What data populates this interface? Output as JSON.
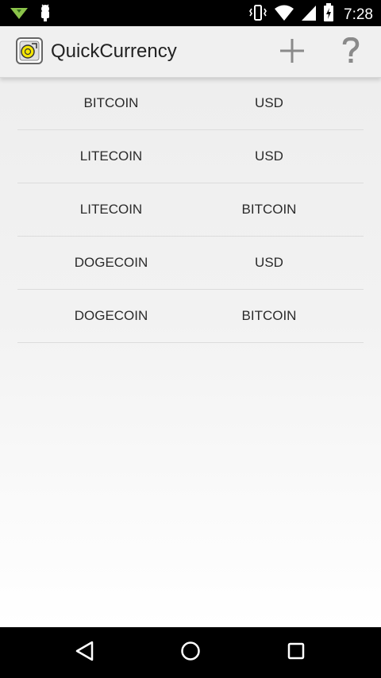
{
  "status_bar": {
    "time": "7:28",
    "icons": [
      "wifi-download-icon",
      "android-debug-icon",
      "vibrate-icon",
      "wifi-icon",
      "signal-icon",
      "battery-charging-icon"
    ]
  },
  "action_bar": {
    "title": "QuickCurrency",
    "app_icon": "quickcurrency-app-icon",
    "add_icon": "plus-icon",
    "help_icon": "question-mark-icon"
  },
  "pairs": [
    {
      "from": "BITCOIN",
      "to": "USD"
    },
    {
      "from": "LITECOIN",
      "to": "USD"
    },
    {
      "from": "LITECOIN",
      "to": "BITCOIN"
    },
    {
      "from": "DOGECOIN",
      "to": "USD"
    },
    {
      "from": "DOGECOIN",
      "to": "BITCOIN"
    }
  ],
  "nav_bar": {
    "icons": [
      "back-icon",
      "home-icon",
      "recents-icon"
    ]
  },
  "colors": {
    "status_bar_bg": "#000000",
    "action_bar_bg": "#f0f0f0",
    "text": "#2b2b2b",
    "divider": "#dcdcdc",
    "icon_gray": "#8a8a8a"
  }
}
